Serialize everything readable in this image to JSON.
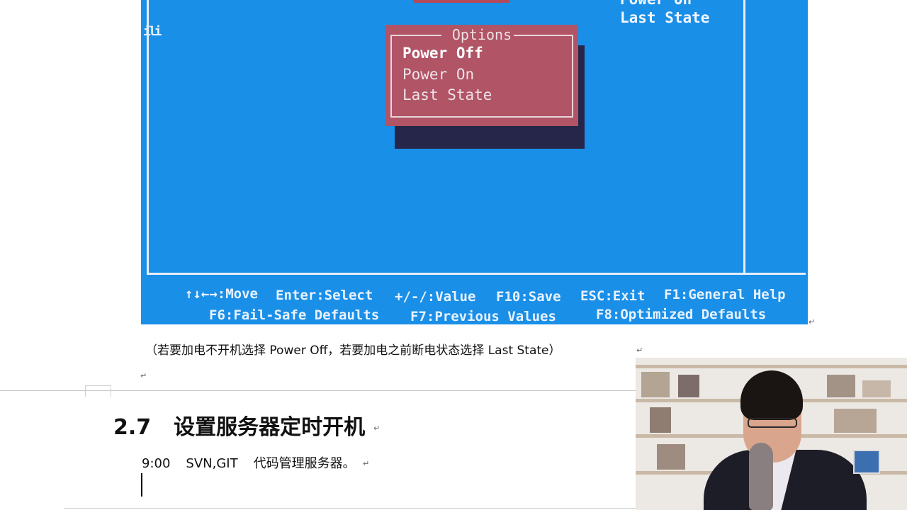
{
  "bios": {
    "left_fragment": "ili",
    "right_panel": {
      "cut_line": "Power On",
      "line": "Last State"
    },
    "popup": {
      "title": "Options",
      "options": [
        {
          "label": "Power Off",
          "selected": true
        },
        {
          "label": "Power On",
          "selected": false
        },
        {
          "label": "Last State",
          "selected": false
        }
      ]
    },
    "keys_row1": [
      "↑↓←→:Move",
      "Enter:Select",
      "+/-/:Value",
      "F10:Save",
      "ESC:Exit",
      "F1:General Help"
    ],
    "keys_row2": [
      "F6:Fail-Safe Defaults",
      "F7:Previous Values",
      "F8:Optimized Defaults"
    ],
    "colors": {
      "background": "#1a8fe8",
      "popup": "#b05466",
      "popup_shadow": "#26264a"
    }
  },
  "document": {
    "caption": "（若要加电不开机选择 Power  Off，若要加电之前断电状态选择 Last  State）",
    "heading_number": "2.7",
    "heading_text": "设置服务器定时开机",
    "line2_time": "9:00",
    "line2_tools": "SVN,GIT",
    "line2_text": "代码管理服务器。",
    "para_mark": "↵"
  },
  "webcam": {
    "icon": "presenter-video-icon"
  }
}
